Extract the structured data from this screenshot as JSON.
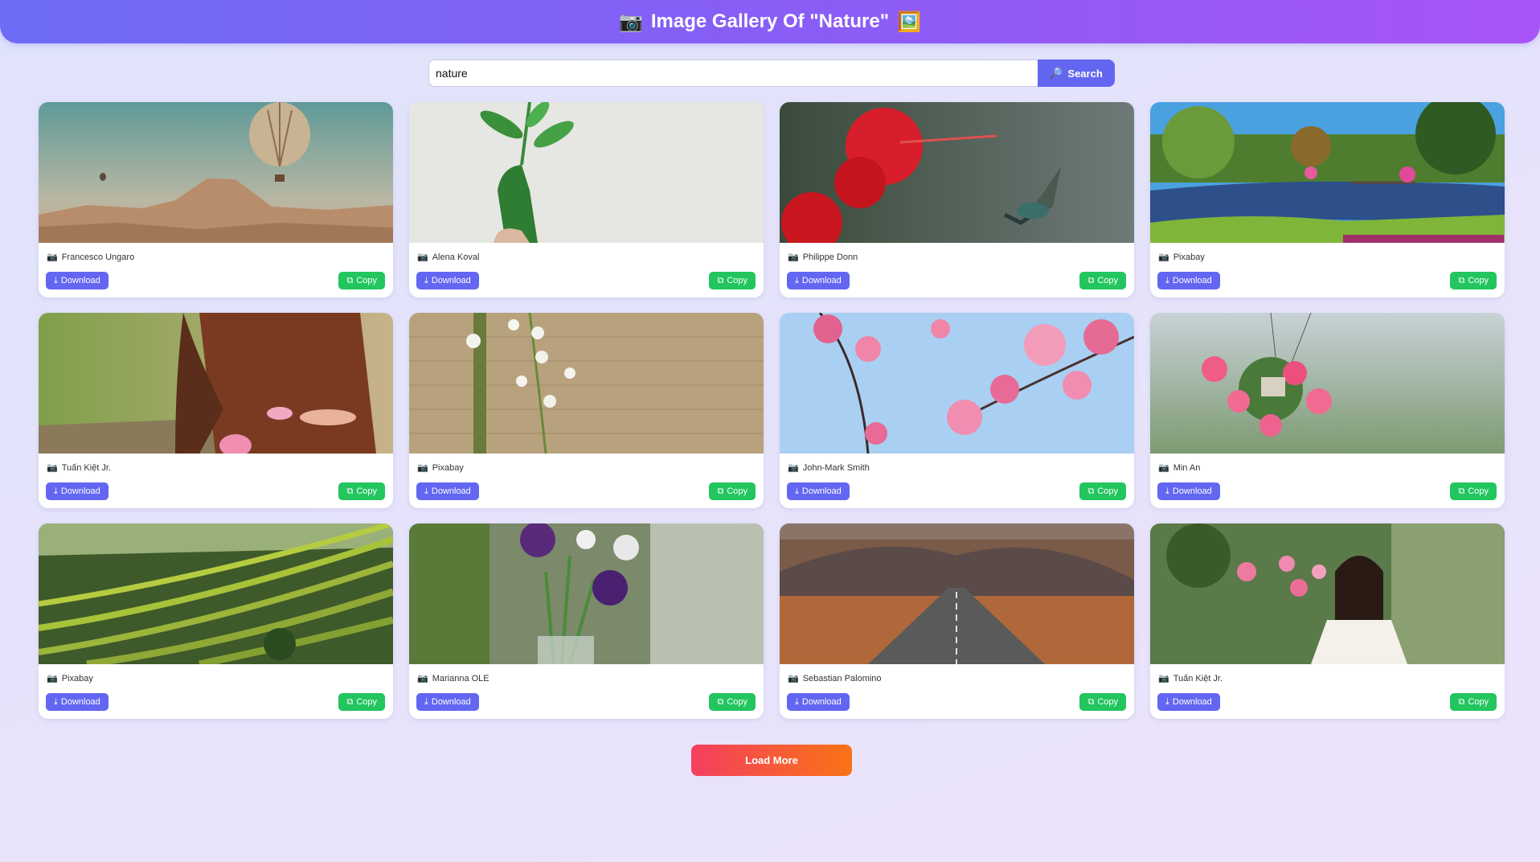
{
  "header": {
    "icon_left": "📷",
    "title": "Image Gallery Of \"Nature\"",
    "icon_right": "🖼️"
  },
  "search": {
    "value": "nature",
    "button_icon": "🔎",
    "button_label": "Search"
  },
  "card_icons": {
    "camera": "📷",
    "download": "⤓",
    "copy": "⧉"
  },
  "cards": [
    {
      "author": "Francesco Ungaro",
      "image": "hot-air-balloon-over-mesa",
      "download_label": "Download",
      "copy_label": "Copy"
    },
    {
      "author": "Alena Koval",
      "image": "green-hand-holding-plant",
      "download_label": "Download",
      "copy_label": "Copy"
    },
    {
      "author": "Philippe Donn",
      "image": "hummingbird-and-red-hibiscus",
      "download_label": "Download",
      "copy_label": "Copy"
    },
    {
      "author": "Pixabay",
      "image": "garden-lake-with-bridge",
      "download_label": "Download",
      "copy_label": "Copy"
    },
    {
      "author": "Tuấn Kiệt Jr.",
      "image": "woman-holding-lotus-flowers",
      "download_label": "Download",
      "copy_label": "Copy"
    },
    {
      "author": "Pixabay",
      "image": "lily-of-the-valley-on-wood",
      "download_label": "Download",
      "copy_label": "Copy"
    },
    {
      "author": "John-Mark Smith",
      "image": "cherry-blossoms-blue-sky",
      "download_label": "Download",
      "copy_label": "Copy"
    },
    {
      "author": "Min An",
      "image": "hanging-pink-flower-pot",
      "download_label": "Download",
      "copy_label": "Copy"
    },
    {
      "author": "Pixabay",
      "image": "rice-terraces",
      "download_label": "Download",
      "copy_label": "Copy"
    },
    {
      "author": "Marianna OLE",
      "image": "purple-flowers-in-vase",
      "download_label": "Download",
      "copy_label": "Copy"
    },
    {
      "author": "Sebastian Palomino",
      "image": "desert-road-to-mountains",
      "download_label": "Download",
      "copy_label": "Copy"
    },
    {
      "author": "Tuấn Kiệt Jr.",
      "image": "woman-with-pink-blossoms",
      "download_label": "Download",
      "copy_label": "Copy"
    }
  ],
  "load_more": {
    "label": "Load More"
  },
  "colors": {
    "accent": "#6366f1",
    "copy_green": "#22c55e",
    "load_more_start": "#f43f5e",
    "load_more_end": "#f97316"
  }
}
